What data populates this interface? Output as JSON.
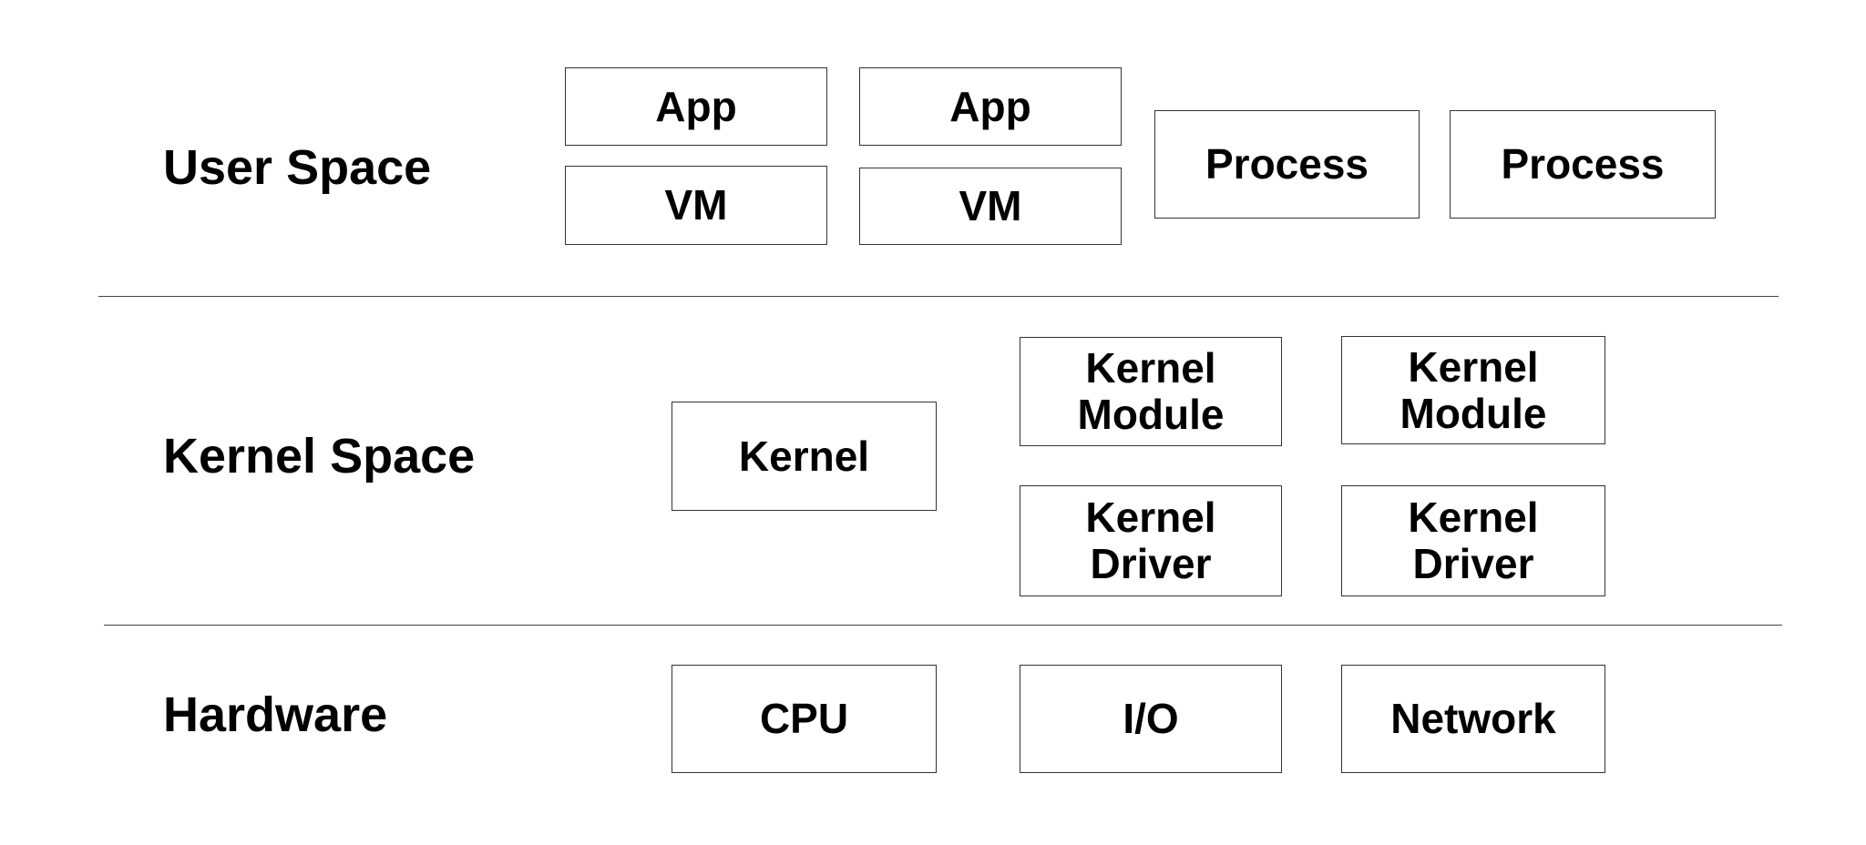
{
  "layers": [
    {
      "label": "User Space",
      "boxes": [
        "App",
        "VM",
        "App",
        "VM",
        "Process",
        "Process"
      ]
    },
    {
      "label": "Kernel Space",
      "boxes": [
        "Kernel",
        "Kernel\nModule",
        "Kernel\nModule",
        "Kernel\nDriver",
        "Kernel\nDriver"
      ]
    },
    {
      "label": "Hardware",
      "boxes": [
        "CPU",
        "I/O",
        "Network"
      ]
    }
  ]
}
